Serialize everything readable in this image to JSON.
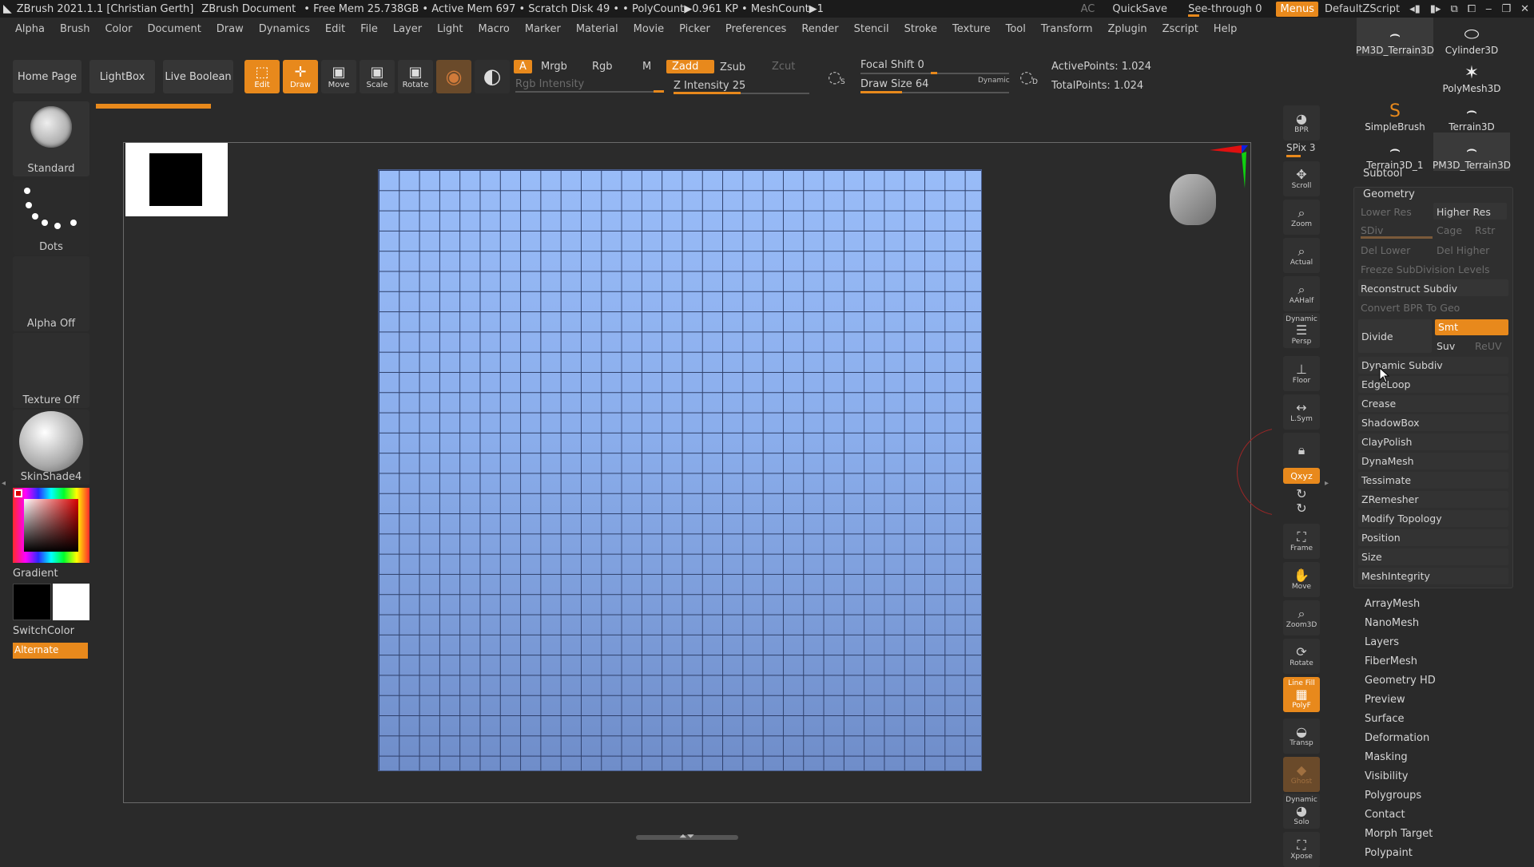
{
  "title_bar": {
    "app": "ZBrush 2021.1.1 [Christian Gerth]",
    "document": "ZBrush Document",
    "stats": "• Free Mem 25.738GB • Active Mem 697 • Scratch Disk 49 • • PolyCount▶0.961 KP • MeshCount▶1",
    "ac": "AC",
    "quicksave": "QuickSave",
    "see_through": "See-through  0",
    "menus": "Menus",
    "script": "DefaultZScript"
  },
  "menu": [
    "Alpha",
    "Brush",
    "Color",
    "Document",
    "Draw",
    "Dynamics",
    "Edit",
    "File",
    "Layer",
    "Light",
    "Macro",
    "Marker",
    "Material",
    "Movie",
    "Picker",
    "Preferences",
    "Render",
    "Stencil",
    "Stroke",
    "Texture",
    "Tool",
    "Transform",
    "Zplugin",
    "Zscript",
    "Help"
  ],
  "toolbar": {
    "home_page": "Home Page",
    "lightbox": "LightBox",
    "live_boolean": "Live Boolean",
    "edit": "Edit",
    "draw": "Draw",
    "move": "Move",
    "scale": "Scale",
    "rotate": "Rotate",
    "a": "A",
    "mrgb": "Mrgb",
    "rgb": "Rgb",
    "m": "M",
    "zadd": "Zadd",
    "zsub": "Zsub",
    "zcut": "Zcut",
    "rgb_intensity": "Rgb Intensity",
    "z_intensity": "Z Intensity 25",
    "focal_shift": "Focal Shift 0",
    "draw_size": "Draw Size 64",
    "dynamic": "Dynamic",
    "active_points": "ActivePoints: 1.024",
    "total_points": "TotalPoints: 1.024",
    "s_label": "S",
    "d_label": "D"
  },
  "left_panel": {
    "standard": "Standard",
    "dots": "Dots",
    "alpha_off": "Alpha Off",
    "texture_off": "Texture Off",
    "material": "SkinShade4",
    "gradient": "Gradient",
    "switch_color": "SwitchColor",
    "alternate": "Alternate"
  },
  "right_strip": {
    "bpr": "BPR",
    "spix": "SPix 3",
    "scroll": "Scroll",
    "zoom": "Zoom",
    "actual": "Actual",
    "aahalf": "AAHalf",
    "dynamic": "Dynamic",
    "persp": "Persp",
    "floor": "Floor",
    "lsym": "L.Sym",
    "xyz": "Qxyz",
    "frame": "Frame",
    "move": "Move",
    "zoom3d": "Zoom3D",
    "rotate": "Rotate",
    "linefill": "Line Fill",
    "polyf": "PolyF",
    "transp": "Transp",
    "ghost": "Ghost",
    "dynamic2": "Dynamic",
    "solo": "Solo",
    "xpose": "Xpose"
  },
  "tools": [
    {
      "label": "Cylinder3D",
      "icon": "cylinder-icon"
    },
    {
      "label": "PM3D_Terrain3D",
      "icon": "terrain-icon"
    },
    {
      "label": "PolyMesh3D",
      "icon": "star-icon"
    },
    {
      "label": "SimpleBrush",
      "icon": "simplebrush-icon"
    },
    {
      "label": "Terrain3D",
      "icon": "terrain-icon"
    },
    {
      "label": "Terrain3D_1",
      "icon": "terrain-icon"
    },
    {
      "label": "PM3D_Terrain3D",
      "icon": "terrain-icon"
    }
  ],
  "subtool": "Subtool",
  "geometry": {
    "title": "Geometry",
    "lower_res": "Lower Res",
    "higher_res": "Higher Res",
    "sdiv": "SDiv",
    "cage": "Cage",
    "rstr": "Rstr",
    "del_lower": "Del Lower",
    "del_higher": "Del Higher",
    "freeze": "Freeze SubDivision Levels",
    "reconstruct": "Reconstruct Subdiv",
    "convert_bpr": "Convert BPR To Geo",
    "divide": "Divide",
    "smt": "Smt",
    "suv": "Suv",
    "reuv": "ReUV",
    "items": [
      "Dynamic Subdiv",
      "EdgeLoop",
      "Crease",
      "ShadowBox",
      "ClayPolish",
      "DynaMesh",
      "Tessimate",
      "ZRemesher",
      "Modify Topology",
      "Position",
      "Size",
      "MeshIntegrity"
    ]
  },
  "sections": [
    "ArrayMesh",
    "NanoMesh",
    "Layers",
    "FiberMesh",
    "Geometry HD",
    "Preview",
    "Surface",
    "Deformation",
    "Masking",
    "Visibility",
    "Polygroups",
    "Contact",
    "Morph Target",
    "Polypaint"
  ],
  "colors": {
    "accent": "#e8891c",
    "grid": "#8aadeb"
  }
}
